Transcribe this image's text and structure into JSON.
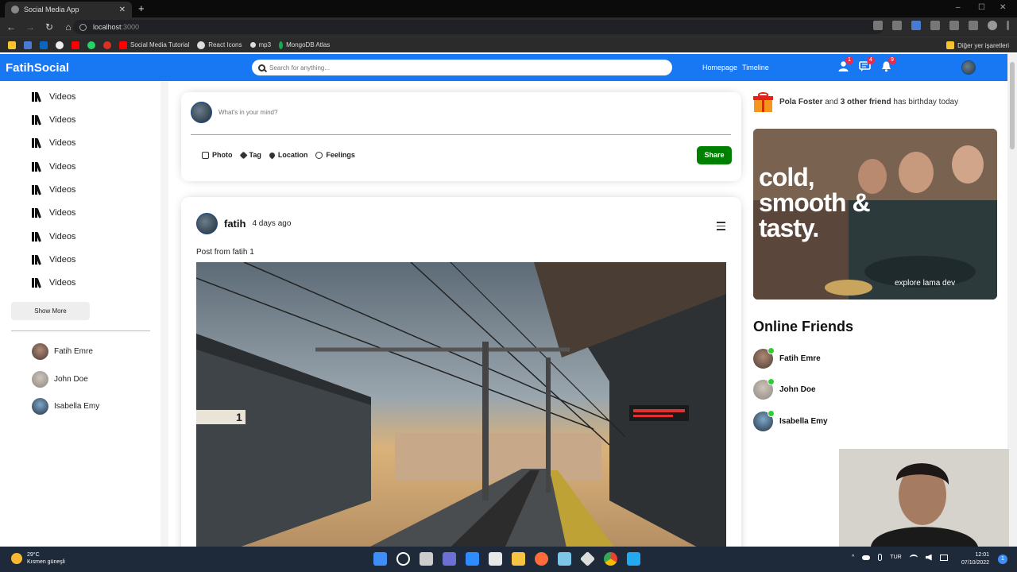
{
  "browser": {
    "tab_title": "Social Media App",
    "new_tab": "+",
    "url_host": "localhost",
    "url_port": ":3000",
    "bookmarks": [
      {
        "label": "",
        "color": "#f9c22e"
      },
      {
        "label": "",
        "color": "#4a7bd0"
      },
      {
        "label": "",
        "color": "#0a66c2"
      },
      {
        "label": "",
        "color": "#eeeeee"
      },
      {
        "label": "",
        "color": "#ff0000"
      },
      {
        "label": "",
        "color": "#25d366"
      },
      {
        "label": "",
        "color": "#d93025"
      },
      {
        "label": "Social Media Tutorial",
        "color": "#ff0000"
      },
      {
        "label": "React Icons",
        "color": "#dddddd"
      },
      {
        "label": "mp3",
        "color": "#dddddd"
      },
      {
        "label": "MongoDB Atlas",
        "color": "#13aa52"
      }
    ],
    "other_bookmarks": "Diğer yer işaretleri"
  },
  "topbar": {
    "logo": "FatihSocial",
    "search_placeholder": "Search for anything...",
    "links": [
      "Homepage",
      "Timeline"
    ],
    "badges": {
      "person": "1",
      "chat": "4",
      "notifications": "9"
    },
    "accent_color": "#1877f2"
  },
  "sidebar": {
    "items": [
      {
        "label": "Videos"
      },
      {
        "label": "Videos"
      },
      {
        "label": "Videos"
      },
      {
        "label": "Videos"
      },
      {
        "label": "Videos"
      },
      {
        "label": "Videos"
      },
      {
        "label": "Videos"
      },
      {
        "label": "Videos"
      },
      {
        "label": "Videos"
      }
    ],
    "show_more": "Show More",
    "friends": [
      {
        "name": "Fatih Emre"
      },
      {
        "name": "John Doe"
      },
      {
        "name": "Isabella Emy"
      }
    ]
  },
  "share": {
    "placeholder": "What's in your mind?",
    "options": [
      "Photo",
      "Tag",
      "Location",
      "Feelings"
    ],
    "button": "Share",
    "button_color": "#008000"
  },
  "post": {
    "username": "fatih",
    "date": "4 days ago",
    "text": "Post from fatih 1",
    "image_platform_sign": "1"
  },
  "rightbar": {
    "birthday": {
      "name": "Pola Foster",
      "middle": " and ",
      "others": "3 other friend",
      "suffix": " has birthday today"
    },
    "ad_headline": "cold, smooth & tasty.",
    "ad_sub": "explore lama dev",
    "online_title": "Online Friends",
    "online_friends": [
      {
        "name": "Fatih Emre"
      },
      {
        "name": "John Doe"
      },
      {
        "name": "Isabella Emy"
      }
    ],
    "online_color": "#32cd32"
  },
  "taskbar": {
    "temp": "29°C",
    "weather": "Kısmen güneşli",
    "lang": "TUR",
    "time": "12:01",
    "date": "07/10/2022",
    "notifications": "1"
  }
}
